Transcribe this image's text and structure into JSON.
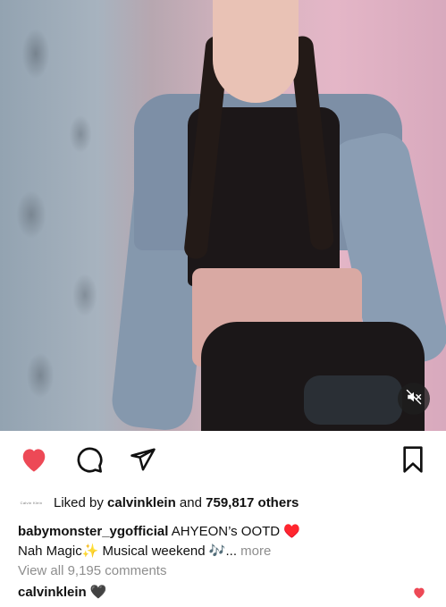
{
  "post": {
    "media": {
      "mute_icon": "speaker-muted-icon"
    },
    "actions": {
      "like_icon": "heart-filled-icon",
      "like_color": "#ed4956",
      "comment_icon": "comment-bubble-icon",
      "share_icon": "send-paper-plane-icon",
      "save_icon": "bookmark-icon"
    },
    "likes": {
      "avatar_text": "Calvin Klein",
      "prefix": "Liked by ",
      "liker": "calvinklein",
      "middle": " and ",
      "others": "759,817 others"
    },
    "caption": {
      "username": "babymonster_ygofficial",
      "line1": " AHYEON’s OOTD ",
      "line1_emoji": "♥️",
      "line2_start": "Nah Magic",
      "sparkles": "✨",
      "line2_mid": " Musical weekend ",
      "notes": "🎶",
      "ellipsis": "...",
      "more": " more"
    },
    "view_comments": "View all 9,195 comments",
    "comment": {
      "username": "calvinklein",
      "heart": "🖤"
    }
  }
}
